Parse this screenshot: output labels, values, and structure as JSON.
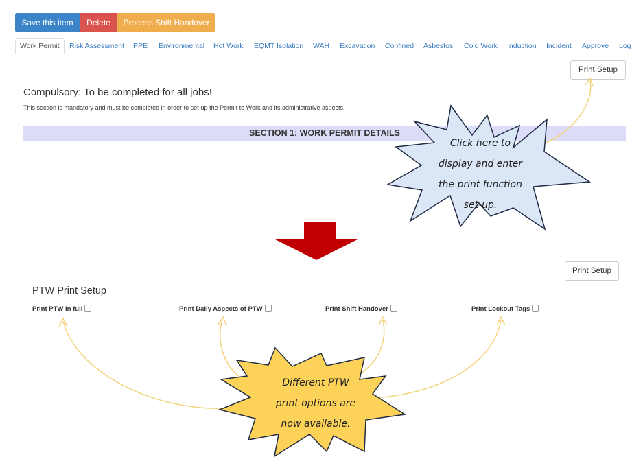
{
  "toolbar": {
    "save_label": "Save this item",
    "delete_label": "Delete",
    "handover_label": "Process Shift Handover"
  },
  "tabs": [
    {
      "label": "Work Permit",
      "active": true
    },
    {
      "label": "Risk Assessment"
    },
    {
      "label": "PPE"
    },
    {
      "label": "Environmental"
    },
    {
      "label": "Hot Work"
    },
    {
      "label": "EQMT Isolation"
    },
    {
      "label": "WAH"
    },
    {
      "label": "Excavation"
    },
    {
      "label": "Confined"
    },
    {
      "label": "Asbestos"
    },
    {
      "label": "Cold Work"
    },
    {
      "label": "Induction"
    },
    {
      "label": "Incident"
    },
    {
      "label": "Approve"
    },
    {
      "label": "Log"
    }
  ],
  "top_panel": {
    "print_setup_label": "Print Setup",
    "heading": "Compulsory: To be completed for all jobs!",
    "description": "This section is mandatory and must be completed in order to set-up the Permit to Work and its administrative aspects.",
    "section_title": "SECTION 1: WORK PERMIT DETAILS"
  },
  "callout_top": {
    "line1": "Click here to",
    "line2": "display and enter",
    "line3": "the print function",
    "line4": "set-up."
  },
  "bottom_panel": {
    "print_setup_label": "Print Setup",
    "title": "PTW Print Setup",
    "options": [
      {
        "label": "Print PTW in full",
        "checked": false
      },
      {
        "label": "Print Daily Aspects of PTW",
        "checked": false
      },
      {
        "label": "Print Shift Handover",
        "checked": false
      },
      {
        "label": "Print Lockout Tags",
        "checked": false
      }
    ]
  },
  "callout_bottom": {
    "line1": "Different PTW",
    "line2": "print options are",
    "line3": "now available."
  },
  "colors": {
    "save": "#3a84c7",
    "delete": "#d9534f",
    "handover": "#f0ad4e",
    "section_bar": "#dcdcf9",
    "arrow": "#c00000",
    "callout_blue": "#dbe6f6",
    "callout_yellow": "#fdd258",
    "link": "#3a7bbf"
  }
}
